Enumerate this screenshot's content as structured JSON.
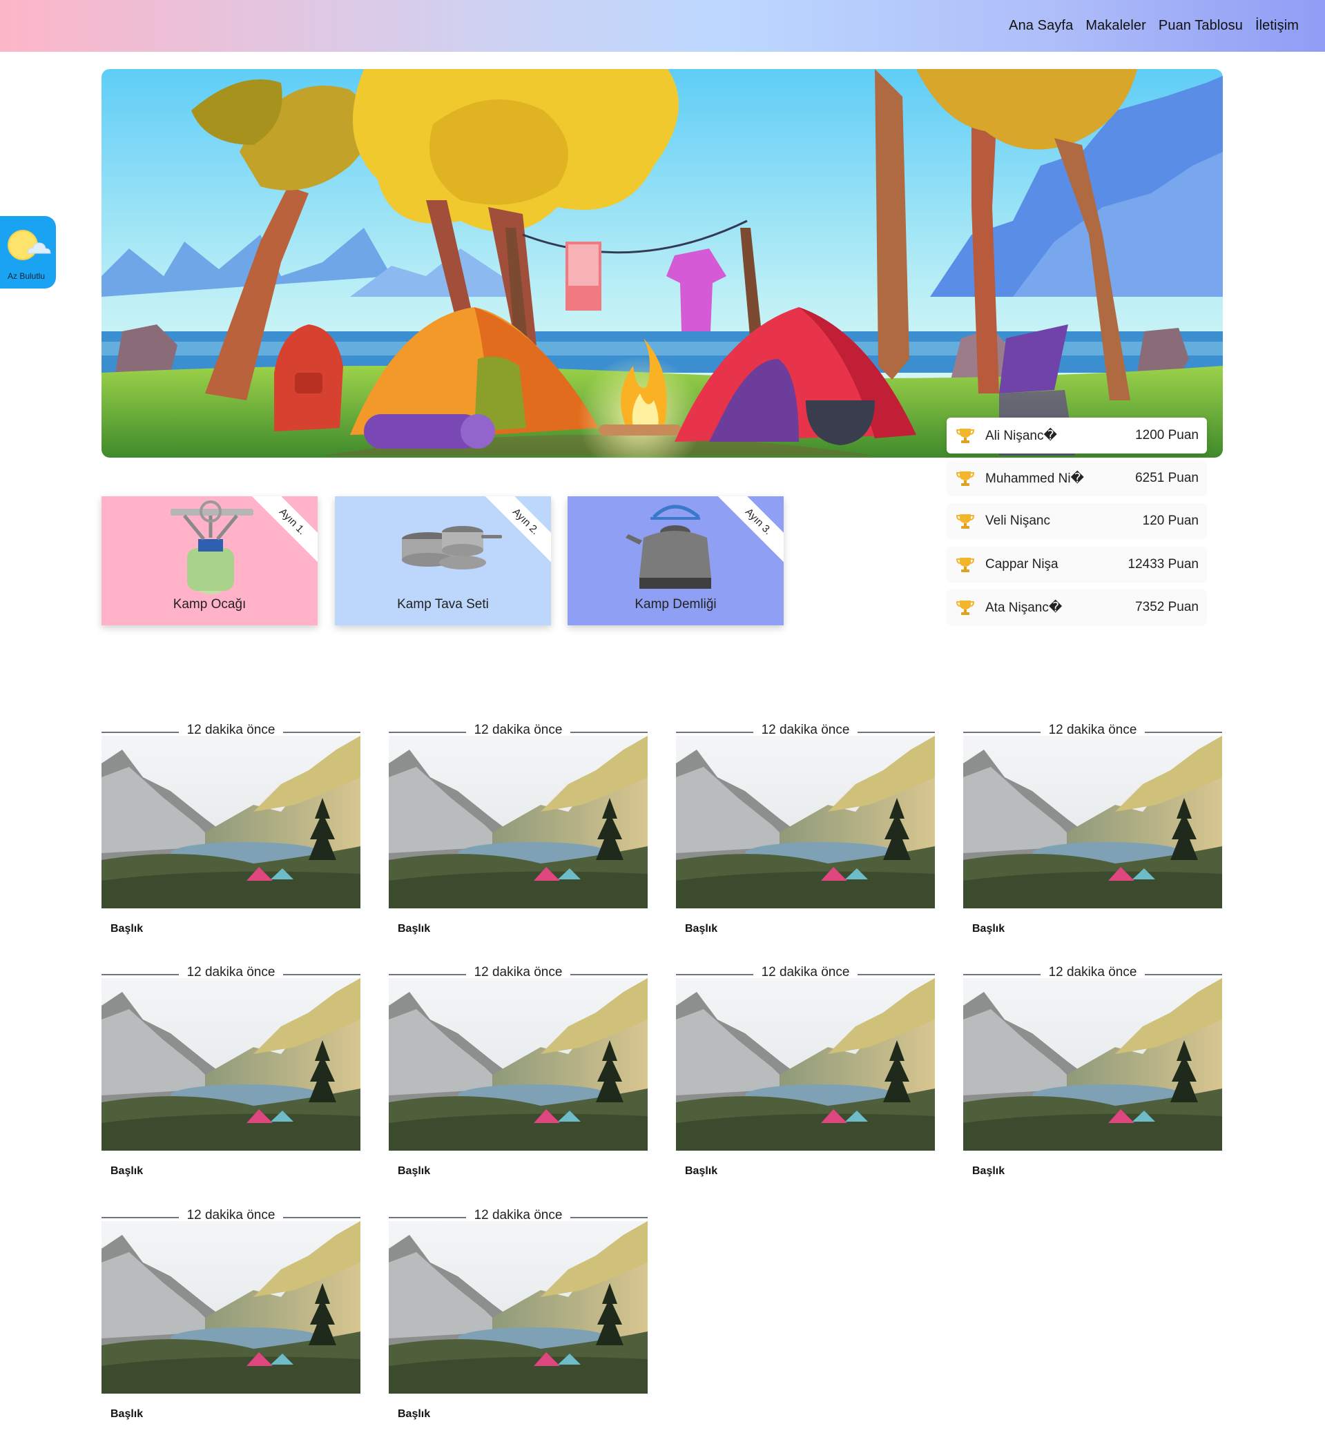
{
  "nav": {
    "items": [
      "Ana Sayfa",
      "Makaleler",
      "Puan Tablosu",
      "İletişim"
    ]
  },
  "weather": {
    "label": "Az Bulutlu",
    "icon": "partly-cloudy-icon"
  },
  "leaderboard": [
    {
      "name": "Ali Nişanc�",
      "score": "1200 Puan"
    },
    {
      "name": "Muhammed Ni�",
      "score": "6251 Puan"
    },
    {
      "name": "Veli Nişanc",
      "score": "120 Puan"
    },
    {
      "name": "Cappar Nişa",
      "score": "12433 Puan"
    },
    {
      "name": "Ata Nişanc�",
      "score": "7352 Puan"
    }
  ],
  "products": [
    {
      "name": "Kamp Ocağı",
      "rank": "Ayın 1.",
      "color": "#ffb2c8"
    },
    {
      "name": "Kamp Tava Seti",
      "rank": "Ayın 2.",
      "color": "#bcd7fb"
    },
    {
      "name": "Kamp Demliği",
      "rank": "Ayın 3.",
      "color": "#8f9ff4"
    }
  ],
  "articles": [
    {
      "date": "12 dakika önce",
      "title": "Başlık"
    },
    {
      "date": "12 dakika önce",
      "title": "Başlık"
    },
    {
      "date": "12 dakika önce",
      "title": "Başlık"
    },
    {
      "date": "12 dakika önce",
      "title": "Başlık"
    },
    {
      "date": "12 dakika önce",
      "title": "Başlık"
    },
    {
      "date": "12 dakika önce",
      "title": "Başlık"
    },
    {
      "date": "12 dakika önce",
      "title": "Başlık"
    },
    {
      "date": "12 dakika önce",
      "title": "Başlık"
    },
    {
      "date": "12 dakika önce",
      "title": "Başlık"
    },
    {
      "date": "12 dakika önce",
      "title": "Başlık"
    }
  ]
}
